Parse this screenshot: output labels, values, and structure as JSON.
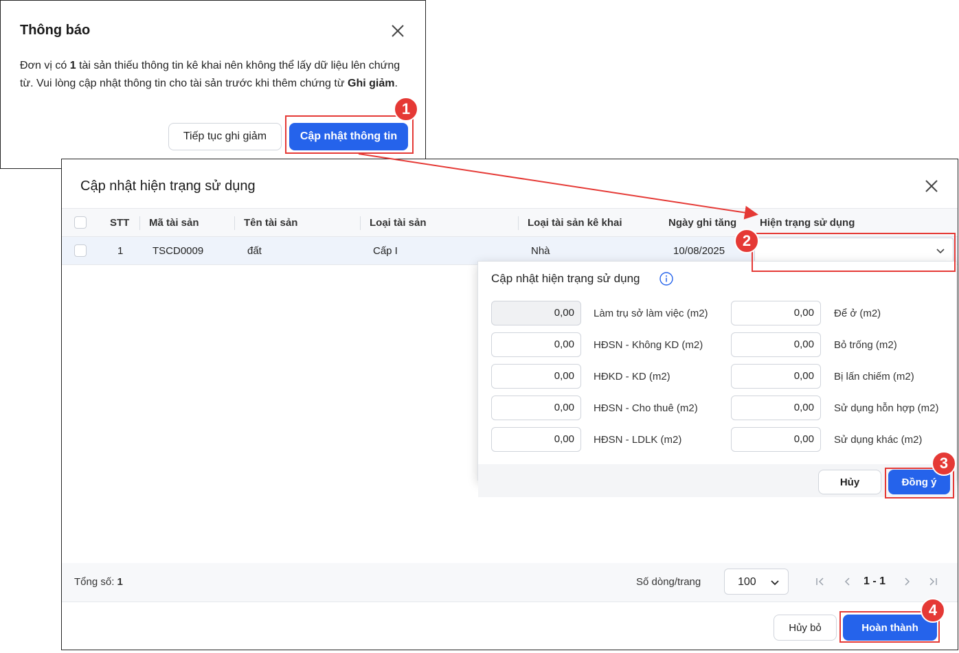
{
  "notice": {
    "title": "Thông báo",
    "body_pre": "Đơn vị có ",
    "body_count": "1",
    "body_mid": " tài sản thiếu thông tin kê khai nên không thể lấy dữ liệu lên chứng từ. Vui lòng cập nhật thông tin cho tài sản trước khi thêm chứng từ ",
    "body_bold": "Ghi giảm",
    "body_end": ".",
    "continue_label": "Tiếp tục ghi giảm",
    "update_label": "Cập nhật thông tin"
  },
  "dialog": {
    "title": "Cập nhật hiện trạng sử dụng",
    "columns": [
      "STT",
      "Mã tài sản",
      "Tên tài sản",
      "Loại tài sản",
      "Loại tài sản kê khai",
      "Ngày ghi tăng",
      "Hiện trạng sử dụng"
    ],
    "rows": [
      {
        "stt": "1",
        "code": "TSCD0009",
        "name": "đất",
        "type": "Cấp I",
        "declared_type": "Nhà",
        "date": "10/08/2025",
        "status": ""
      }
    ],
    "total_label": "Tổng số: ",
    "total_value": "1",
    "rows_per_page_label": "Số dòng/trang",
    "rows_per_page": "100",
    "page_range": "1 - 1",
    "cancel_label": "Hủy bỏ",
    "finish_label": "Hoàn thành"
  },
  "popover": {
    "title": "Cập nhật hiện trạng sử dụng",
    "left_fields": [
      {
        "label": "Làm trụ sở làm việc (m2)",
        "value": "0,00",
        "disabled": true
      },
      {
        "label": "HĐSN - Không KD (m2)",
        "value": "0,00",
        "disabled": false
      },
      {
        "label": "HĐKD - KD (m2)",
        "value": "0,00",
        "disabled": false
      },
      {
        "label": "HĐSN - Cho thuê (m2)",
        "value": "0,00",
        "disabled": false
      },
      {
        "label": "HĐSN - LDLK (m2)",
        "value": "0,00",
        "disabled": false
      }
    ],
    "right_fields": [
      {
        "label": "Để ở (m2)",
        "value": "0,00"
      },
      {
        "label": "Bỏ trống (m2)",
        "value": "0,00"
      },
      {
        "label": "Bị lấn chiếm (m2)",
        "value": "0,00"
      },
      {
        "label": "Sử dụng hỗn hợp (m2)",
        "value": "0,00"
      },
      {
        "label": "Sử dụng khác (m2)",
        "value": "0,00"
      }
    ],
    "cancel_label": "Hủy",
    "ok_label": "Đồng ý"
  },
  "steps": [
    "1",
    "2",
    "3",
    "4"
  ],
  "colors": {
    "primary": "#2563eb",
    "annotation": "#e53935",
    "row_highlight": "#eef3fb"
  }
}
